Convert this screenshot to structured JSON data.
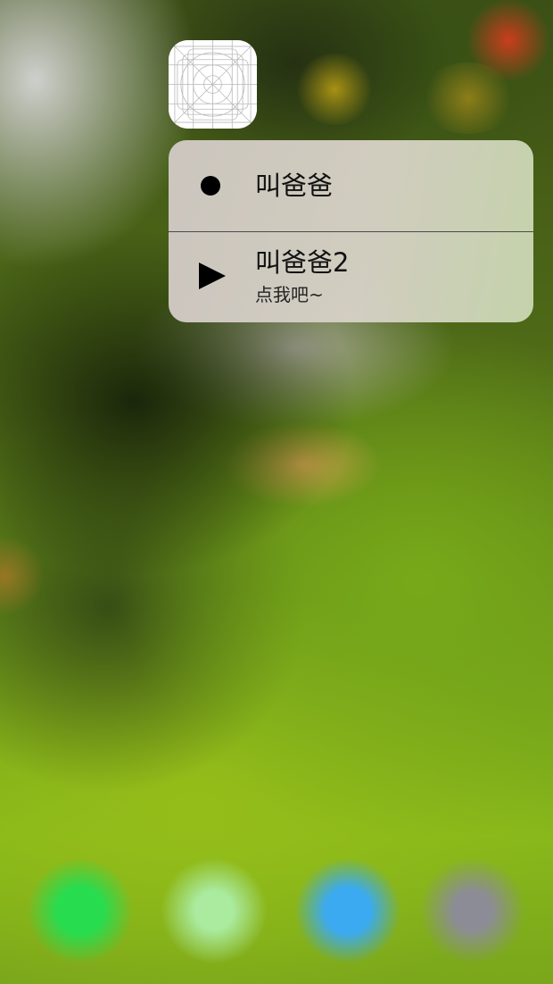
{
  "app_icon": {
    "icon": "icon-template-grid-icon"
  },
  "quick_actions": [
    {
      "title": "叫爸爸",
      "subtitle": "",
      "icon": "filled-circle-icon"
    },
    {
      "title": "叫爸爸2",
      "subtitle": "点我吧~",
      "icon": "play-icon"
    }
  ],
  "colors": {
    "menu_background": "#d2cbc4",
    "text": "#111111",
    "separator": "#4a4a4a"
  }
}
